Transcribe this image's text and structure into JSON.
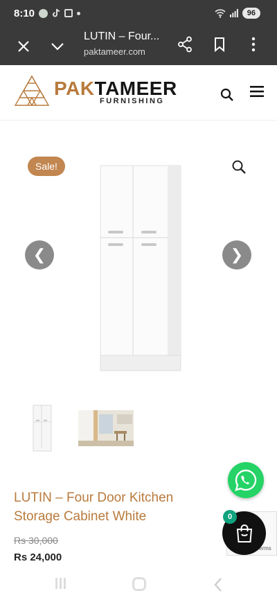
{
  "status_bar": {
    "time": "8:10",
    "battery": "96",
    "icons": [
      "notification-icon",
      "tiktok-icon",
      "screenshot-icon",
      "dot-icon",
      "wifi-icon",
      "signal-icon"
    ]
  },
  "browser": {
    "title": "LUTIN – Four...",
    "url": "paktameer.com"
  },
  "header": {
    "brand_part1": "PAK",
    "brand_part2": "TAMEER",
    "brand_sub": "FURNISHING"
  },
  "gallery": {
    "badge": "Sale!",
    "prev_label": "❮",
    "next_label": "❯"
  },
  "product": {
    "title": "LUTIN – Four Door Kitchen Storage Cabinet White",
    "old_price": "Rs 30,000",
    "new_price": "Rs 24,000"
  },
  "floating": {
    "cart_count": "0",
    "recaptcha_text": "Terms"
  },
  "colors": {
    "accent": "#b87a3c",
    "sale_badge": "#c28650",
    "whatsapp": "#25d366",
    "cart_badge": "#10a37f",
    "browser_bar": "#3a3a3a"
  }
}
